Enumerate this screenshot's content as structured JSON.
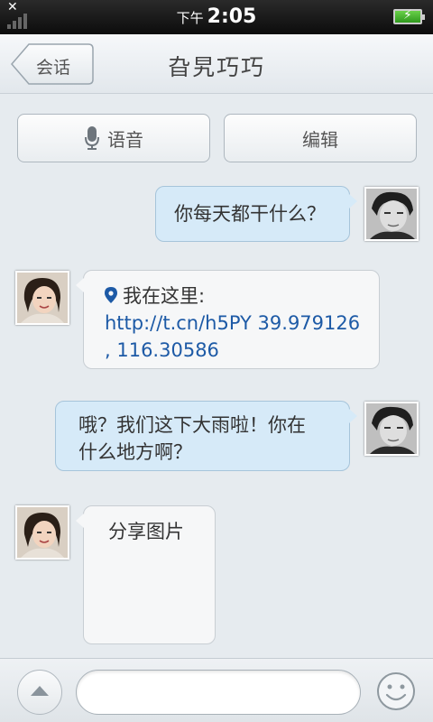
{
  "status_bar": {
    "close_glyph": "✕",
    "ampm": "下午",
    "time": "2:05",
    "icons": [
      "signal-icon",
      "battery-charging-icon"
    ]
  },
  "header": {
    "back_label": "会话",
    "title": "旮旯巧巧"
  },
  "actions": {
    "voice_label": "语音",
    "edit_label": "编辑"
  },
  "messages": [
    {
      "direction": "out",
      "text": "你每天都干什么？"
    },
    {
      "direction": "in",
      "label": "我在这里:",
      "link": "http://t.cn/h5PY 39.979126",
      "link2": ", 116.30586"
    },
    {
      "direction": "out",
      "line1": "哦？我们这下大雨啦！你在",
      "line2": "什么地方啊？"
    },
    {
      "direction": "in",
      "text": "分享图片"
    }
  ],
  "composer": {
    "placeholder": "",
    "value": ""
  },
  "colors": {
    "outgoing_bubble": "#d6eaf8",
    "incoming_bubble": "#f6f7f8",
    "link": "#1d5aa6"
  }
}
